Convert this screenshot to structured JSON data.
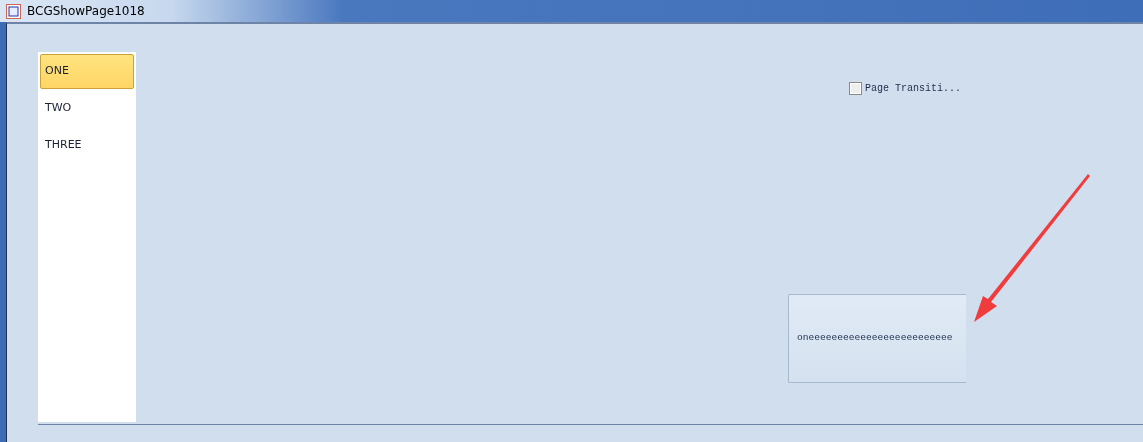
{
  "window": {
    "title": "BCGShowPage1018"
  },
  "pages": [
    {
      "label": "ONE",
      "selected": true
    },
    {
      "label": "TWO",
      "selected": false
    },
    {
      "label": "THREE",
      "selected": false
    }
  ],
  "checkbox": {
    "label": "Page Transiti...",
    "checked": false
  },
  "panel": {
    "text": "oneeeeeeeeeeeeeeeeeeeeeeeee"
  }
}
